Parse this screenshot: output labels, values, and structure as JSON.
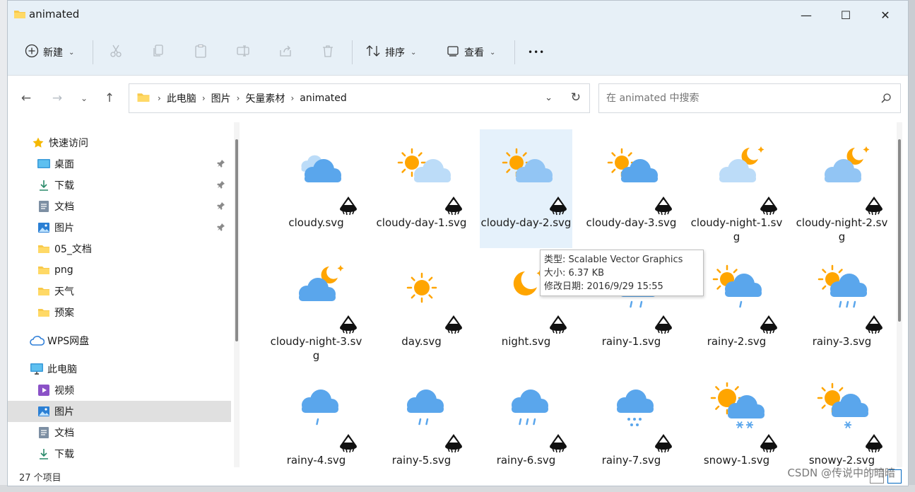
{
  "window": {
    "title": "animated",
    "minimize": "—",
    "maximize": "☐",
    "close": "✕"
  },
  "toolbar": {
    "new_label": "新建",
    "sort_label": "排序",
    "view_label": "查看",
    "more_label": "•••"
  },
  "address": {
    "crumbs": [
      "此电脑",
      "图片",
      "矢量素材",
      "animated"
    ]
  },
  "search": {
    "placeholder": "在 animated 中搜索"
  },
  "sidebar": {
    "items": [
      {
        "label": "快速访问",
        "icon": "star-icon"
      },
      {
        "label": "桌面",
        "icon": "desktop-icon",
        "pinned": true
      },
      {
        "label": "下载",
        "icon": "download-icon",
        "pinned": true
      },
      {
        "label": "文档",
        "icon": "document-icon",
        "pinned": true
      },
      {
        "label": "图片",
        "icon": "pictures-icon",
        "pinned": true
      },
      {
        "label": "05_文档",
        "icon": "folder-icon"
      },
      {
        "label": "png",
        "icon": "folder-icon"
      },
      {
        "label": "天气",
        "icon": "folder-icon"
      },
      {
        "label": "预案",
        "icon": "folder-icon"
      },
      {
        "label": "WPS网盘",
        "icon": "cloud-drive-icon"
      },
      {
        "label": "此电脑",
        "icon": "computer-icon"
      },
      {
        "label": "视频",
        "icon": "video-icon"
      },
      {
        "label": "图片",
        "icon": "pictures-icon",
        "selected": true
      },
      {
        "label": "文档",
        "icon": "document-icon"
      },
      {
        "label": "下载",
        "icon": "download-icon"
      }
    ]
  },
  "files": [
    {
      "name": "cloudy.svg",
      "kind": "cloudy"
    },
    {
      "name": "cloudy-day-1.svg",
      "kind": "cloudy-day-1"
    },
    {
      "name": "cloudy-day-2.svg",
      "kind": "cloudy-day-2",
      "selected": true
    },
    {
      "name": "cloudy-day-3.svg",
      "kind": "cloudy-day-3"
    },
    {
      "name": "cloudy-night-1.svg",
      "kind": "cloudy-night-1"
    },
    {
      "name": "cloudy-night-2.svg",
      "kind": "cloudy-night-2"
    },
    {
      "name": "cloudy-night-3.svg",
      "kind": "cloudy-night-3"
    },
    {
      "name": "day.svg",
      "kind": "day"
    },
    {
      "name": "night.svg",
      "kind": "night"
    },
    {
      "name": "rainy-1.svg",
      "kind": "rainy-1"
    },
    {
      "name": "rainy-2.svg",
      "kind": "rainy-2"
    },
    {
      "name": "rainy-3.svg",
      "kind": "rainy-3"
    },
    {
      "name": "rainy-4.svg",
      "kind": "rainy-4"
    },
    {
      "name": "rainy-5.svg",
      "kind": "rainy-5"
    },
    {
      "name": "rainy-6.svg",
      "kind": "rainy-6"
    },
    {
      "name": "rainy-7.svg",
      "kind": "rainy-7"
    },
    {
      "name": "snowy-1.svg",
      "kind": "snowy-1"
    },
    {
      "name": "snowy-2.svg",
      "kind": "snowy-2"
    }
  ],
  "tooltip": {
    "type_line": "类型: Scalable Vector Graphics",
    "size_line": "大小: 6.37 KB",
    "date_line": "修改日期: 2016/9/29 15:55"
  },
  "status": {
    "count": "27 个项目"
  },
  "watermark": "CSDN @传说中的暗暗",
  "colors": {
    "cloud": "#5aa6ec",
    "cloud_light": "#bcdcf8",
    "sun": "#ffa500",
    "accent": "#0067c0"
  }
}
